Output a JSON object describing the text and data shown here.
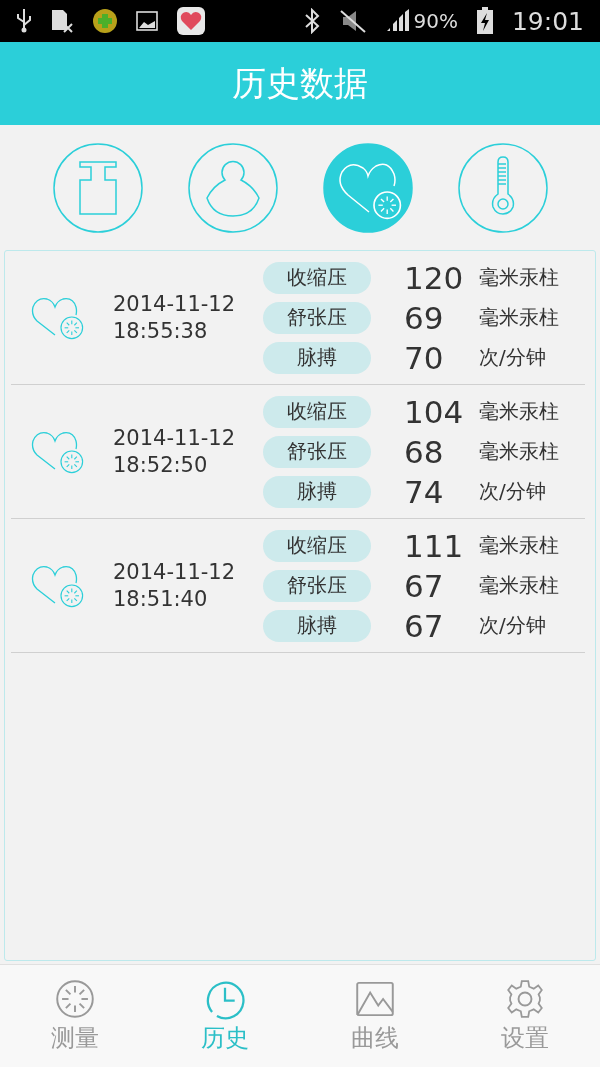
{
  "status_bar": {
    "battery": "90%",
    "time": "19:01"
  },
  "header": {
    "title": "历史数据"
  },
  "categories": [
    {
      "kind": "weight",
      "selected": false
    },
    {
      "kind": "person",
      "selected": false
    },
    {
      "kind": "heart",
      "selected": true
    },
    {
      "kind": "thermometer",
      "selected": false
    }
  ],
  "records": [
    {
      "date": "2014-11-12",
      "time": "18:55:38",
      "readings": [
        {
          "label": "收缩压",
          "value": "120",
          "unit": "毫米汞柱"
        },
        {
          "label": "舒张压",
          "value": "69",
          "unit": "毫米汞柱"
        },
        {
          "label": "脉搏",
          "value": "70",
          "unit": "次/分钟"
        }
      ]
    },
    {
      "date": "2014-11-12",
      "time": "18:52:50",
      "readings": [
        {
          "label": "收缩压",
          "value": "104",
          "unit": "毫米汞柱"
        },
        {
          "label": "舒张压",
          "value": "68",
          "unit": "毫米汞柱"
        },
        {
          "label": "脉搏",
          "value": "74",
          "unit": "次/分钟"
        }
      ]
    },
    {
      "date": "2014-11-12",
      "time": "18:51:40",
      "readings": [
        {
          "label": "收缩压",
          "value": "111",
          "unit": "毫米汞柱"
        },
        {
          "label": "舒张压",
          "value": "67",
          "unit": "毫米汞柱"
        },
        {
          "label": "脉搏",
          "value": "67",
          "unit": "次/分钟"
        }
      ]
    }
  ],
  "nav": [
    {
      "kind": "measure",
      "label": "测量",
      "selected": false
    },
    {
      "kind": "history",
      "label": "历史",
      "selected": true
    },
    {
      "kind": "curve",
      "label": "曲线",
      "selected": false
    },
    {
      "kind": "settings",
      "label": "设置",
      "selected": false
    }
  ]
}
